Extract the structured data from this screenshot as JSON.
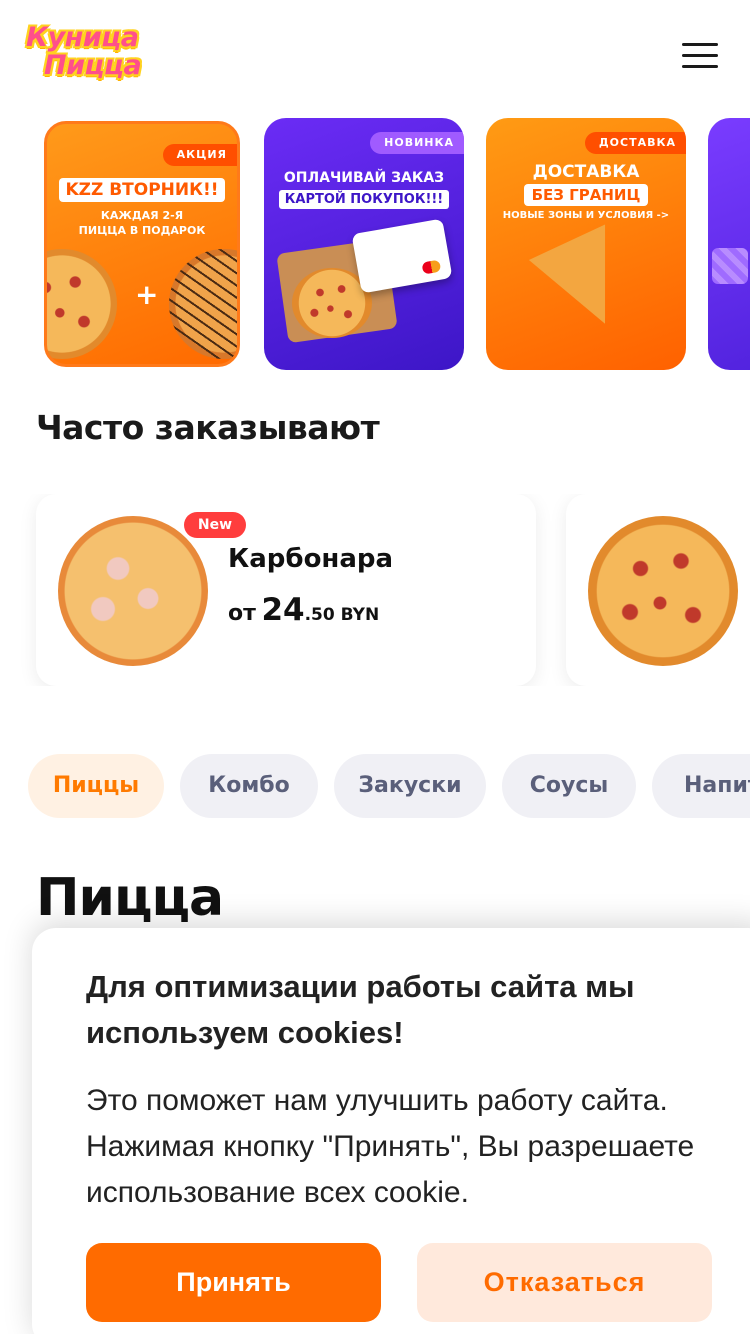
{
  "header": {
    "logo_line1": "Куница",
    "logo_line2": "Пицца"
  },
  "stories": [
    {
      "tag": "АКЦИЯ",
      "headline": "KZZ ВТОРНИК!!",
      "subline": "КАЖДАЯ 2-Я ПИЦЦА В ПОДАРОК",
      "extra": "+"
    },
    {
      "tag": "НОВИНКА",
      "headline": "ОПЛАЧИВАЙ ЗАКАЗ",
      "subline": "КАРТОЙ ПОКУПОК!!!"
    },
    {
      "tag": "ДОСТАВКА",
      "headline": "ДОСТАВКА",
      "subline": "БЕЗ ГРАНИЦ",
      "extra": "НОВЫЕ ЗОНЫ И УСЛОВИЯ ->"
    }
  ],
  "frequent": {
    "title": "Часто заказывают",
    "items": [
      {
        "badge": "New",
        "name": "Карбонара",
        "price_prefix": "от",
        "price_main": "24",
        "price_small": ".50 BYN"
      }
    ]
  },
  "categories": [
    "Пиццы",
    "Комбо",
    "Закуски",
    "Соусы",
    "Напит"
  ],
  "section_heading": "Пицца",
  "cookie": {
    "title": "Для оптимизации работы сайта мы используем cookies!",
    "text": "Это поможет нам улучшить работу сайта. Нажимая кнопку \"Принять\", Вы разрешаете использование всех cookie.",
    "accept": "Принять",
    "decline": "Отказаться"
  },
  "colors": {
    "accent": "#ff6b00",
    "accent_light": "#ffe9dc",
    "chip_bg": "#f0f0f5",
    "chip_active_bg": "#fff1e3"
  }
}
